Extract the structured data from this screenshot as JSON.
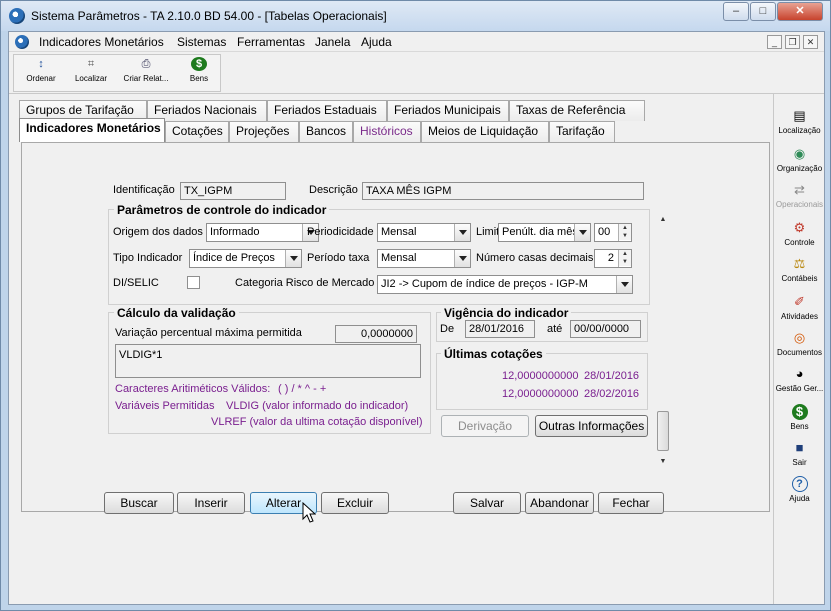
{
  "window": {
    "title": "Sistema Parâmetros -   TA 2.10.0 BD 54.00 - [Tabelas Operacionais]",
    "minimize": "–",
    "maximize": "□",
    "close": "✕"
  },
  "menu": {
    "items": [
      "Indicadores Monetários",
      "Sistemas",
      "Ferramentas",
      "Janela",
      "Ajuda"
    ],
    "mdi_min": "_",
    "mdi_restore": "❐",
    "mdi_close": "✕"
  },
  "toolbar": {
    "items": [
      {
        "label": "Ordenar",
        "icon": "sort-az-icon",
        "glyph": "↕"
      },
      {
        "label": "Localizar",
        "icon": "find-icon",
        "glyph": "⌗"
      },
      {
        "label": "Criar Relat...",
        "icon": "printer-icon",
        "glyph": "⎙"
      },
      {
        "label": "Bens",
        "icon": "money-bag-icon",
        "glyph": "$"
      }
    ]
  },
  "sidebar": {
    "items": [
      {
        "label": "Localização",
        "icon": "location-icon",
        "glyph": "▤",
        "color": "#333333"
      },
      {
        "label": "Organização",
        "icon": "organization-icon",
        "glyph": "◉",
        "color": "#2e8b57"
      },
      {
        "label": "Operacionais",
        "icon": "operations-icon",
        "glyph": "⇄",
        "color": "#888888"
      },
      {
        "label": "Controle",
        "icon": "control-icon",
        "glyph": "⚙",
        "color": "#c0392b"
      },
      {
        "label": "Contábeis",
        "icon": "scale-icon",
        "glyph": "⚖",
        "color": "#b8860b"
      },
      {
        "label": "Atividades",
        "icon": "pin-icon",
        "glyph": "✐",
        "color": "#c0392b"
      },
      {
        "label": "Documentos",
        "icon": "document-icon",
        "glyph": "◎",
        "color": "#d35400"
      },
      {
        "label": "Gestão Ger...",
        "icon": "eye-icon",
        "glyph": "◕",
        "color": "#333333"
      },
      {
        "label": "Bens",
        "icon": "money-bag-icon",
        "glyph": "$",
        "color": "#1e7b1e"
      },
      {
        "label": "Sair",
        "icon": "exit-door-icon",
        "glyph": "■",
        "color": "#1f3f7a"
      },
      {
        "label": "Ajuda",
        "icon": "help-icon",
        "glyph": "?",
        "color": "#1f5fa8"
      }
    ]
  },
  "tabs_row1": [
    "Grupos de Tarifação",
    "Feriados Nacionais",
    "Feriados Estaduais",
    "Feriados Municipais",
    "Taxas de Referência"
  ],
  "tabs_row2": [
    "Indicadores Monetários",
    "Cotações",
    "Projeções",
    "Bancos",
    "Históricos",
    "Meios de Liquidação",
    "Tarifação"
  ],
  "form": {
    "identificacao_label": "Identificação",
    "identificacao_value": "TX_IGPM",
    "descricao_label": "Descrição",
    "descricao_value": "TAXA MÊS IGPM",
    "params_title": "Parâmetros de controle do indicador",
    "origem_label": "Origem dos dados",
    "origem_value": "Informado",
    "periodicidade_label": "Periodicidade",
    "periodicidade_value": "Mensal",
    "limite_label": "Limite",
    "limite_value": "Penúlt. dia mês",
    "limite_spin": "00",
    "tipo_label": "Tipo Indicador",
    "tipo_value": "Índice de Preços",
    "periodo_label": "Período taxa",
    "periodo_value": "Mensal",
    "casas_label": "Número casas decimais",
    "casas_value": "2",
    "diselic_label": "DI/SELIC",
    "categoria_label": "Categoria Risco de Mercado",
    "categoria_value": "JI2 -> Cupom de índice de preços - IGP-M",
    "calc_title": "Cálculo da validação",
    "variacao_label": "Variação percentual máxima permitida",
    "variacao_value": "0,0000000",
    "formula_value": "VLDIG*1",
    "caracteres_label": "Caracteres Aritiméticos Válidos:",
    "caracteres_value": "( ) / * ^ - +",
    "variaveis_label": "Variáveis Permitidas",
    "vldig_text": "VLDIG (valor informado do indicador)",
    "vlref_text": "VLREF (valor da ultima cotação disponível)",
    "vigencia_title": "Vigência do indicador",
    "de_label": "De",
    "de_value": "28/01/2016",
    "ate_label": "até",
    "ate_value": "00/00/0000",
    "ultimas_title": "Últimas cotações",
    "cotacoes": [
      {
        "valor": "12,0000000000",
        "data": "28/01/2016"
      },
      {
        "valor": "12,0000000000",
        "data": "28/02/2016"
      }
    ],
    "derivacao_button": "Derivação",
    "outras_button": "Outras Informações"
  },
  "actions": {
    "buscar": "Buscar",
    "inserir": "Inserir",
    "alterar": "Alterar",
    "excluir": "Excluir",
    "salvar": "Salvar",
    "abandonar": "Abandonar",
    "fechar": "Fechar"
  }
}
